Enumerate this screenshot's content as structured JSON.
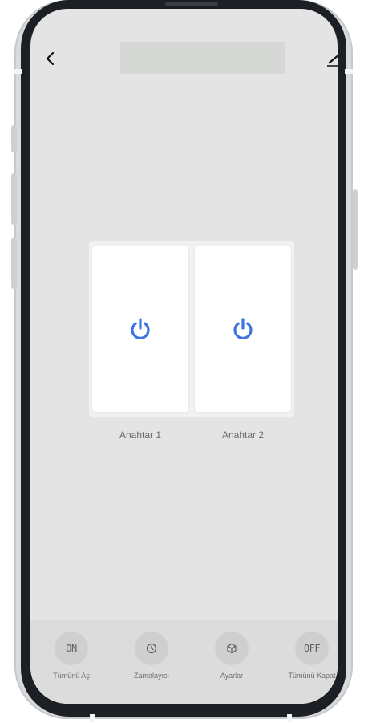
{
  "header": {
    "back_icon": "chevron-left-icon",
    "title": "",
    "edit_icon": "pencil-icon"
  },
  "switches": [
    {
      "label": "Anahtar 1",
      "icon": "power-icon",
      "icon_color": "#3d74e3"
    },
    {
      "label": "Anahtar 2",
      "icon": "power-icon",
      "icon_color": "#3d74e3"
    }
  ],
  "bottom_actions": [
    {
      "glyph": "ON",
      "label": "Tümünü Aç"
    },
    {
      "glyph": "",
      "icon": "clock-icon",
      "label": "Zamalayıcı"
    },
    {
      "glyph": "",
      "icon": "cube-icon",
      "label": "Ayarlar"
    },
    {
      "glyph": "OFF",
      "label": "Tümünü Kapat"
    }
  ],
  "colors": {
    "screen_bg": "#e4e4e4",
    "accent": "#3d74e3",
    "bottom_bar": "#dcdcdc"
  }
}
